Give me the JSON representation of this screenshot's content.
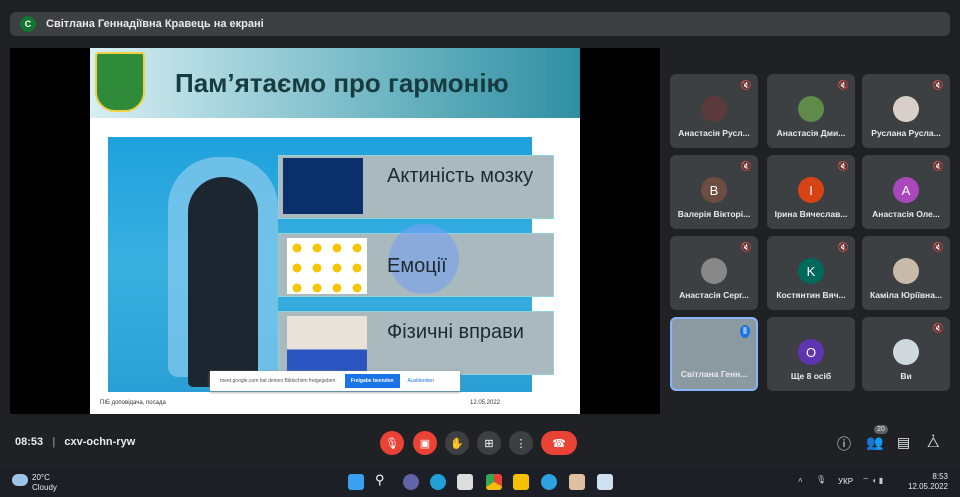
{
  "banner": {
    "avatar": "С",
    "text": "Світлана Геннадіївна Кравець на екрані"
  },
  "slide": {
    "title": "Пам’ятаємо про гармонію",
    "rows": [
      "Актиність мозку",
      "Емоції",
      "Фізичні вправи"
    ],
    "footer_left": "ПІБ доповідача, посада",
    "footer_right": "12.05.2022",
    "notice": {
      "text": "meet.google.com hat deinen Bildschirm freigegeben.",
      "stop": "Freigabe beenden",
      "hide": "Ausblenden"
    }
  },
  "tiles": [
    {
      "name": "Анастасія Русл...",
      "muted": true,
      "color": "#5a3a3a"
    },
    {
      "name": "Анастасія Дми...",
      "muted": true,
      "color": "#5f8a4a"
    },
    {
      "name": "Руслана Русла...",
      "muted": true,
      "color": "#d8d0c8"
    },
    {
      "name": "Валерія Вікторі...",
      "muted": true,
      "initial": "B",
      "color": "#6d4c41"
    },
    {
      "name": "Ірина Вячеслав...",
      "muted": true,
      "initial": "I",
      "color": "#d84315"
    },
    {
      "name": "Анастасія Оле...",
      "muted": true,
      "initial": "A",
      "color": "#ab47bc"
    },
    {
      "name": "Анастасія Серг...",
      "muted": true,
      "color": "#888"
    },
    {
      "name": "Костянтин Вяч...",
      "muted": true,
      "initial": "K",
      "color": "#00695c"
    },
    {
      "name": "Каміла Юріївна...",
      "muted": true,
      "color": "#c9b9a9"
    },
    {
      "name": "Світлана Генн...",
      "muted": false,
      "speaking": true
    },
    {
      "name": "Ще 8 осіб",
      "initial": "O",
      "color": "#5e35b1"
    },
    {
      "name": "Ви",
      "muted": true,
      "color": "#cfd8dc"
    }
  ],
  "meeting": {
    "time": "08:53",
    "code": "cxv-ochn-ryw",
    "participants": "20"
  },
  "taskbar": {
    "temp": "20°C",
    "weather": "Cloudy",
    "lang": "УКР",
    "time": "8:53",
    "date": "12.05.2022"
  }
}
